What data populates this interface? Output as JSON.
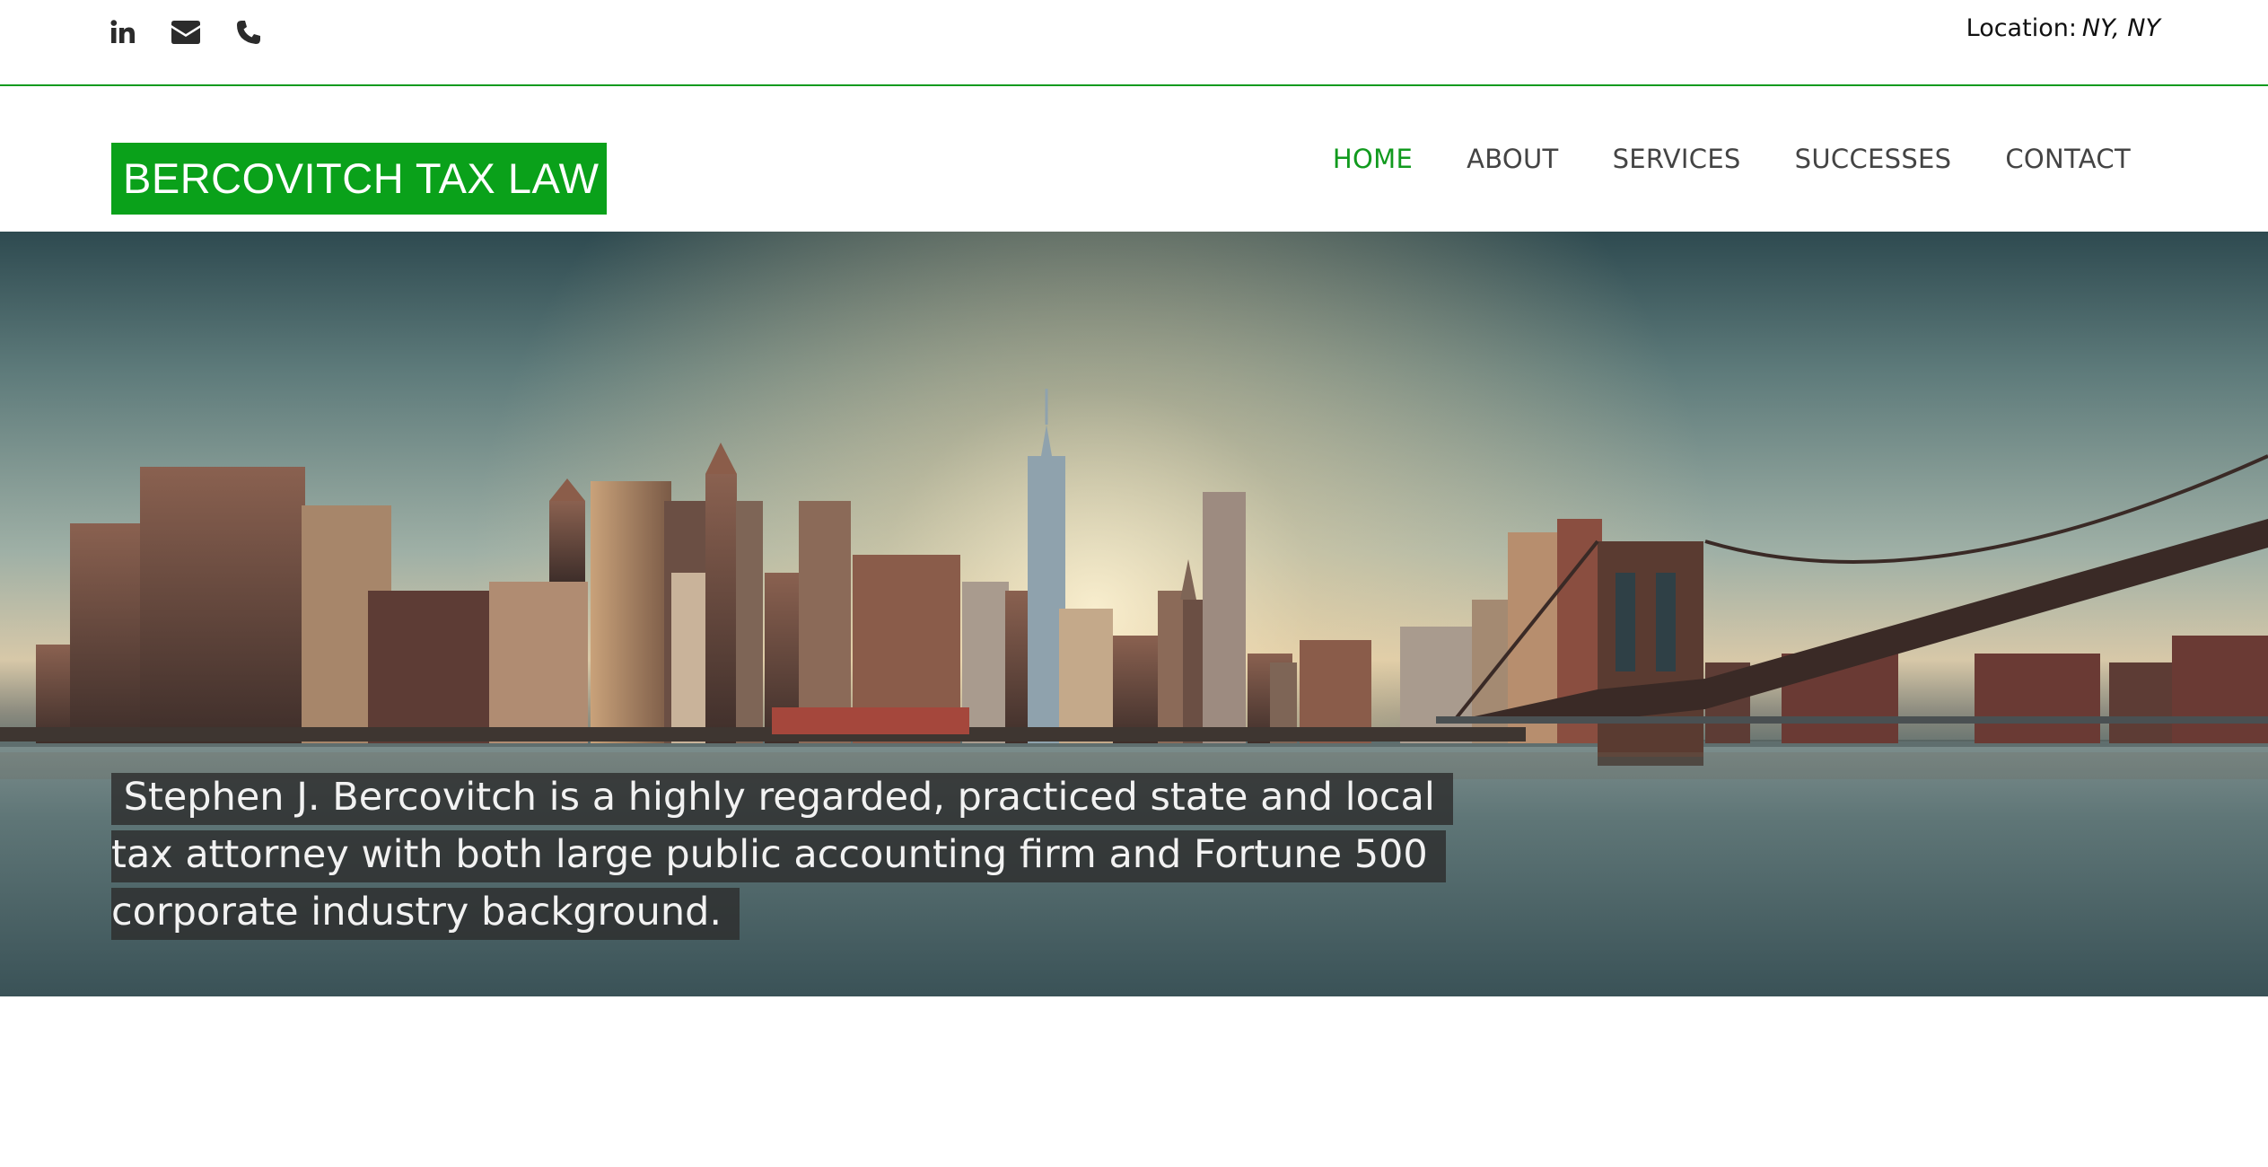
{
  "topbar": {
    "social_icons": [
      "linkedin-icon",
      "envelope-icon",
      "phone-icon"
    ],
    "location_label": "Location:",
    "location_value": "NY, NY"
  },
  "header": {
    "logo_text": "BERCOVITCH TAX LAW",
    "nav": [
      {
        "label": "HOME",
        "active": true
      },
      {
        "label": "ABOUT",
        "active": false
      },
      {
        "label": "SERVICES",
        "active": false
      },
      {
        "label": "SUCCESSES",
        "active": false
      },
      {
        "label": "CONTACT",
        "active": false
      }
    ]
  },
  "hero": {
    "image": "new-york-skyline-brooklyn-bridge",
    "tagline": " Stephen J. Bercovitch is a highly regarded, practiced state and local tax attorney with both large public accounting firm and Fortune 500 corporate industry background."
  },
  "colors": {
    "accent": "#119a1e",
    "logo_bg": "#0aa11a",
    "nav_text": "#444444",
    "tagline_bg": "#2d2d2d"
  }
}
